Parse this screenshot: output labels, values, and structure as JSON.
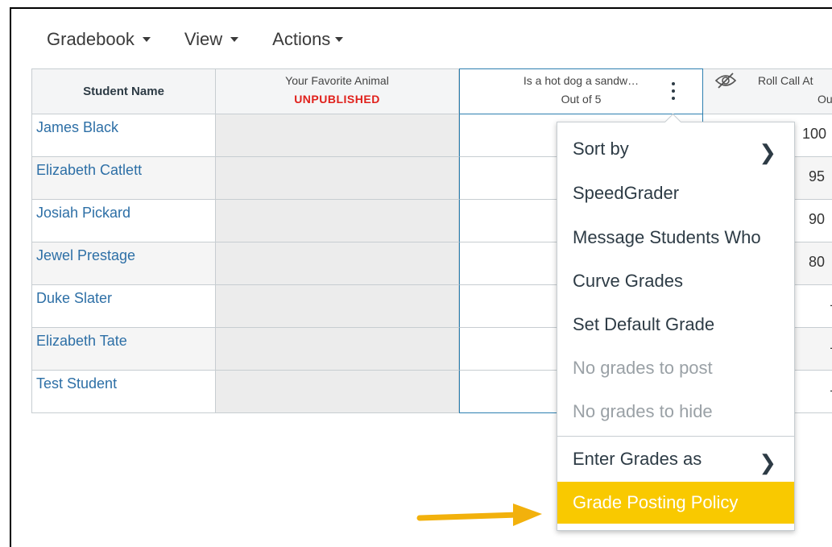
{
  "nav": {
    "gradebook": "Gradebook",
    "view": "View",
    "actions": "Actions"
  },
  "columns": {
    "student_name": "Student Name",
    "favorite_animal": {
      "title": "Your Favorite Animal",
      "status": "UNPUBLISHED"
    },
    "hot_dog": {
      "title": "Is a hot dog a sandw…",
      "subtitle": "Out of 5"
    },
    "roll_call": {
      "title": "Roll Call At",
      "subtitle": "Out of"
    }
  },
  "students": [
    {
      "name": "James Black",
      "roll_call": "100"
    },
    {
      "name": "Elizabeth Catlett",
      "roll_call": "95"
    },
    {
      "name": "Josiah Pickard",
      "roll_call": "90"
    },
    {
      "name": "Jewel Prestage",
      "roll_call": "80"
    },
    {
      "name": "Duke Slater",
      "roll_call": "–"
    },
    {
      "name": "Elizabeth Tate",
      "roll_call": "–"
    },
    {
      "name": "Test Student",
      "roll_call": "–"
    }
  ],
  "menu": {
    "sort_by": "Sort by",
    "speedgrader": "SpeedGrader",
    "message_students": "Message Students Who",
    "curve_grades": "Curve Grades",
    "set_default_grade": "Set Default Grade",
    "no_grades_post": "No grades to post",
    "no_grades_hide": "No grades to hide",
    "enter_grades_as": "Enter Grades as",
    "grade_posting_policy": "Grade Posting Policy"
  },
  "colors": {
    "link": "#2d6fa6",
    "unpublished": "#e0201b",
    "highlight": "#f9c900",
    "arrow": "#f2b10c"
  }
}
